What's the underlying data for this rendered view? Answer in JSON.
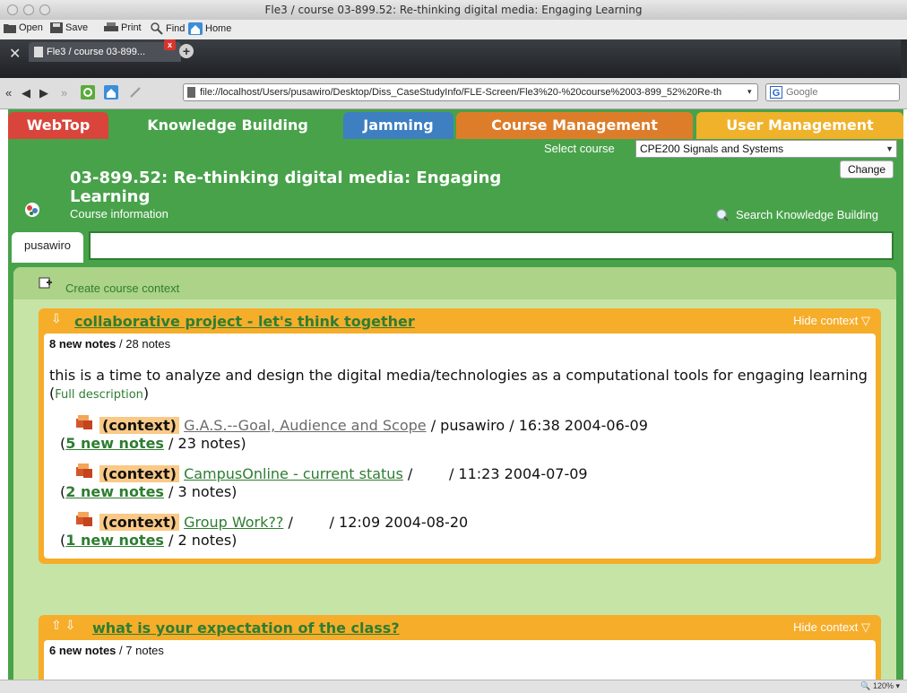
{
  "window": {
    "title": "Fle3 / course 03-899.52: Re-thinking digital media: Engaging Learning"
  },
  "toolbar": {
    "open": "Open",
    "save": "Save",
    "print": "Print",
    "find": "Find",
    "home": "Home"
  },
  "browser_tab": {
    "label": "Fle3 / course 03-899...",
    "close": "x"
  },
  "address": {
    "url": "file://localhost/Users/pusawiro/Desktop/Diss_CaseStudyInfo/FLE-Screen/Fle3%20-%20course%2003-899_52%20Re-th",
    "search_placeholder": "Google"
  },
  "app_tabs": [
    {
      "label": "WebTop",
      "color": "#d9453b"
    },
    {
      "label": "Knowledge Building",
      "color": "#48a24a"
    },
    {
      "label": "Jamming",
      "color": "#3d7fc1"
    },
    {
      "label": "Course Management",
      "color": "#dd7d2a"
    },
    {
      "label": "User Management",
      "color": "#f0b22a"
    }
  ],
  "course": {
    "title": "03-899.52: Re-thinking digital media: Engaging Learning",
    "info_link": "Course information",
    "select_label": "Select course",
    "select_value": "CPE200 Signals and Systems",
    "change_button": "Change",
    "search_link": "Search Knowledge Building"
  },
  "user": {
    "name": "pusawiro"
  },
  "panel": {
    "create_context": "Create course context"
  },
  "contexts": [
    {
      "title": "collaborative project - let's think together",
      "hide": "Hide context",
      "new_notes": "8 new notes",
      "total_notes": "/ 28 notes",
      "description": "this is a time to analyze and design the digital media/technologies as a computational tools for engaging learning",
      "full_description": "Full description",
      "items": [
        {
          "tag": "(context)",
          "title": "G.A.S.--Goal, Audience and Scope",
          "meta": "/ pusawiro / 16:38 2004-06-09",
          "new_notes": "5 new notes",
          "total": "/ 23 notes)"
        },
        {
          "tag": "(context)",
          "title": "CampusOnline - current status",
          "meta": "/        / 11:23 2004-07-09",
          "new_notes": "2 new notes",
          "total": "/ 3 notes)"
        },
        {
          "tag": "(context)",
          "title": "Group Work??",
          "meta": "/        / 12:09 2004-08-20",
          "new_notes": "1 new notes",
          "total": "/ 2 notes)"
        }
      ]
    },
    {
      "title": "what is your expectation of the class?",
      "hide": "Hide context",
      "new_notes": "6 new notes",
      "total_notes": "/ 7 notes"
    }
  ],
  "status": {
    "zoom": "120%"
  }
}
